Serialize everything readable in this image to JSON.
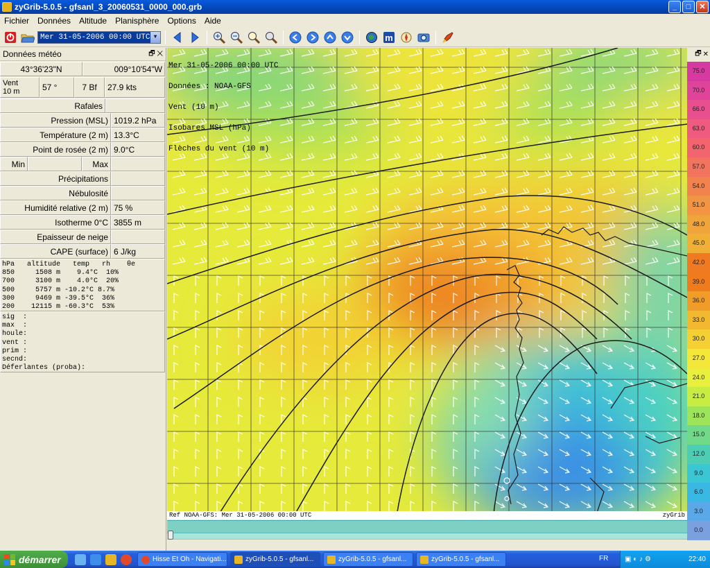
{
  "window": {
    "title": "zyGrib-5.0.5 - gfsanl_3_20060531_0000_000.grb",
    "buttons": [
      "_",
      "□",
      "✕"
    ]
  },
  "menu": [
    "Fichier",
    "Données",
    "Altitude",
    "Planisphère",
    "Options",
    "Aide"
  ],
  "toolbar": {
    "date": "Mer 31-05-2006 00:00 UTC"
  },
  "panel": {
    "title": "Données météo",
    "lat": "43°36'23\"N",
    "lon": "009°10'54\"W",
    "wind_label": "Vent\n10 m",
    "wind_dir": "57 °",
    "wind_bf": "7 Bf",
    "wind_kts": "27.9  kts",
    "rows": [
      {
        "label": "Rafales",
        "value": ""
      },
      {
        "label": "Pression (MSL)",
        "value": "1019.2 hPa"
      },
      {
        "label": "Température (2 m)",
        "value": "13.3°C"
      },
      {
        "label": "Point de rosée (2 m)",
        "value": "9.0°C"
      }
    ],
    "min_label": "Min",
    "max_label": "Max",
    "rows2": [
      {
        "label": "Précipitations",
        "value": ""
      },
      {
        "label": "Nébulosité",
        "value": ""
      },
      {
        "label": "Humidité relative (2 m)",
        "value": "75 %"
      },
      {
        "label": "Isotherme 0°C",
        "value": "3855 m"
      },
      {
        "label": "Epaisseur de neige",
        "value": ""
      },
      {
        "label": "CAPE (surface)",
        "value": "6 J/kg"
      }
    ],
    "altitude_table": "hPa   altitude   temp   rh    θe\n850     1508 m    9.4°C  10%\n700     3100 m    4.0°C  20%\n500     5757 m -10.2°C 8.7%\n300     9469 m -39.5°C  36%\n200    12115 m -60.3°C  53%",
    "waves": "sig  :\nmax  :\nhoule:\nvent :\nprim :\nsecnd:\nDéferlantes (proba):"
  },
  "map": {
    "info_lines": [
      "Mer 31-05-2006 00:00 UTC",
      "Données : NOAA-GFS",
      "Vent (10 m)",
      "Isobares MSL (hPa)",
      "Flèches du vent (10 m)"
    ],
    "ref": "Ref NOAA-GFS: Mer 31-05-2006 00:00 UTC",
    "brand": "zyGrib"
  },
  "legend": {
    "values": [
      "75.0",
      "70.0",
      "66.0",
      "63.0",
      "60.0",
      "57.0",
      "54.0",
      "51.0",
      "48.0",
      "45.0",
      "42.0",
      "39.0",
      "36.0",
      "33.0",
      "30.0",
      "27.0",
      "24.0",
      "21.0",
      "18.0",
      "15.0",
      "12.0",
      "9.0",
      "6.0",
      "3.0",
      "0.0"
    ],
    "colors": [
      "#d63aa0",
      "#e0449a",
      "#e84f8e",
      "#ef5b80",
      "#f2656f",
      "#f2735e",
      "#f2834e",
      "#f19443",
      "#f0a43c",
      "#f0b036",
      "#f07a22",
      "#ee7c1e",
      "#f09c28",
      "#f2b82f",
      "#f5d035",
      "#f5e63a",
      "#e8ef3c",
      "#c8ec42",
      "#9ee45a",
      "#70d98a",
      "#4ccdb4",
      "#3bc6d4",
      "#39b8e4",
      "#5aa8e8",
      "#7aa0e0"
    ]
  },
  "taskbar": {
    "start": "démarrer",
    "tasks": [
      "Hisse Et Oh - Navigati...",
      "zyGrib-5.0.5 - gfsanl...",
      "zyGrib-5.0.5 - gfsanl...",
      "zyGrib-5.0.5 - gfsanl..."
    ],
    "lang": "FR",
    "clock": "22:40"
  }
}
